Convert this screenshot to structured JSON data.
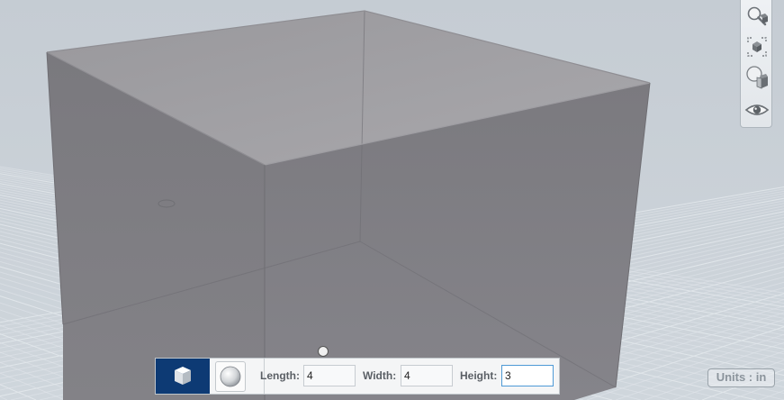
{
  "viewport": {
    "name": "3d-viewport",
    "background_color": "#c9d0d6",
    "grid_color": "#e6ebef",
    "box_color": "#7d7c82"
  },
  "view_toolbar": {
    "buttons": [
      {
        "name": "zoom-icon"
      },
      {
        "name": "fit-to-view-icon"
      },
      {
        "name": "perspective-icon"
      },
      {
        "name": "visibility-eye-icon"
      }
    ]
  },
  "primitive_panel": {
    "shapes": [
      {
        "name": "box-shape-icon",
        "selected": true
      },
      {
        "name": "sphere-shape-icon",
        "selected": false
      }
    ],
    "length_label": "Length:",
    "length_value": "4",
    "width_label": "Width:",
    "width_value": "4",
    "height_label": "Height:",
    "height_value": "3",
    "accent_color": "#0d3a74"
  },
  "units": {
    "label": "Units : in"
  }
}
